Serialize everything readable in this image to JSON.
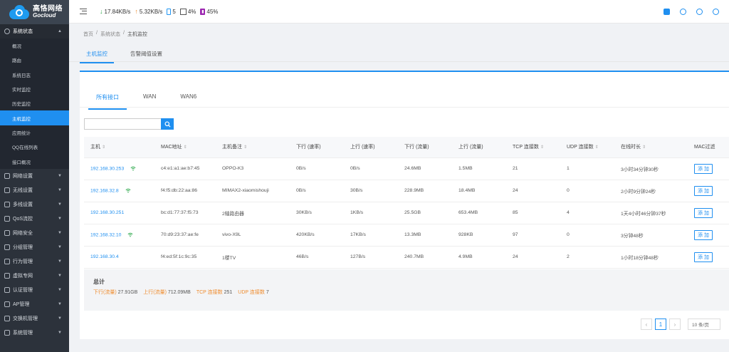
{
  "brand": {
    "name_cn": "高恪网络",
    "name_en": "Gocloud"
  },
  "sidebar": {
    "open_group": "系统状态",
    "sub_items": [
      "概况",
      "路由",
      "系统日志",
      "实时监控",
      "历史监控",
      "主机监控",
      "应用统计",
      "QQ在线列表",
      "接口概况"
    ],
    "active_sub": "主机监控",
    "groups": [
      "网络设置",
      "无线设置",
      "多线设置",
      "QoS流控",
      "网络安全",
      "分组管理",
      "行为管理",
      "虚拟专网",
      "认证管理",
      "AP管理",
      "交换机管理",
      "系统管理"
    ]
  },
  "topbar": {
    "download_rate": "17.84KB/s",
    "upload_rate": "5.32KB/s",
    "cpu": "5",
    "memory": "4%",
    "battery": "45%"
  },
  "breadcrumb": [
    "首页",
    "系统状态",
    "主机监控"
  ],
  "page_tabs": [
    "主机监控",
    "告警阈值设置"
  ],
  "interface_tabs": [
    "所有接口",
    "WAN",
    "WAN6"
  ],
  "search": {
    "placeholder": ""
  },
  "table": {
    "columns": [
      "主机",
      "MAC地址",
      "主机备注",
      "下行 (速率)",
      "上行 (速率)",
      "下行 (流量)",
      "上行 (流量)",
      "TCP 连接数",
      "UDP 连接数",
      "在线时长",
      "MAC过滤"
    ],
    "rows": [
      {
        "ip": "192.168.30.253",
        "wifi": true,
        "mac": "c4:e1:a1:ae:b7:45",
        "note": "OPPO-K3",
        "down_rate": "0B/s",
        "up_rate": "0B/s",
        "down_traffic": "24.6MB",
        "up_traffic": "1.5MB",
        "tcp": "21",
        "udp": "1",
        "online": "3小时34分钟30秒",
        "action": "添 加"
      },
      {
        "ip": "192.168.32.8",
        "wifi": true,
        "mac": "f4:f5:db:22:aa:86",
        "note": "MIMAX2-xiaomishouji",
        "down_rate": "0B/s",
        "up_rate": "30B/s",
        "down_traffic": "228.9MB",
        "up_traffic": "18.4MB",
        "tcp": "24",
        "udp": "0",
        "online": "2小时9分钟24秒",
        "action": "添 加"
      },
      {
        "ip": "192.168.30.251",
        "wifi": false,
        "mac": "bc:d1:77:37:f5:73",
        "note": "2轴路由器",
        "down_rate": "30KB/s",
        "up_rate": "1KB/s",
        "down_traffic": "25.5GB",
        "up_traffic": "653.4MB",
        "tcp": "85",
        "udp": "4",
        "online": "1天4小时46分钟37秒",
        "action": "添 加"
      },
      {
        "ip": "192.168.32.10",
        "wifi": true,
        "mac": "70:d9:23:37:ae:fe",
        "note": "vivo-X9L",
        "down_rate": "420KB/s",
        "up_rate": "17KB/s",
        "down_traffic": "13.3MB",
        "up_traffic": "928KB",
        "tcp": "97",
        "udp": "0",
        "online": "3分钟48秒",
        "action": "添 加"
      },
      {
        "ip": "192.168.30.4",
        "wifi": false,
        "mac": "f4:ed:5f:1c:9c:35",
        "note": "1楼TV",
        "down_rate": "46B/s",
        "up_rate": "127B/s",
        "down_traffic": "240.7MB",
        "up_traffic": "4.9MB",
        "tcp": "24",
        "udp": "2",
        "online": "1小时18分钟48秒",
        "action": "添 加"
      }
    ]
  },
  "total": {
    "title": "总计",
    "items": [
      {
        "label": "下行(流量)",
        "value": "27.91GB"
      },
      {
        "label": "上行(流量)",
        "value": "712.09MB"
      },
      {
        "label": "TCP 连接数",
        "value": "251"
      },
      {
        "label": "UDP 连接数",
        "value": "7"
      }
    ]
  },
  "pagination": {
    "prev": "‹",
    "current": "1",
    "next": "›",
    "page_size": "10 条/页"
  },
  "colors": {
    "accent": "#1f8ff0",
    "sidebar": "#2c323b",
    "wifi": "#2ba84a",
    "orange": "#ef8c2e"
  }
}
